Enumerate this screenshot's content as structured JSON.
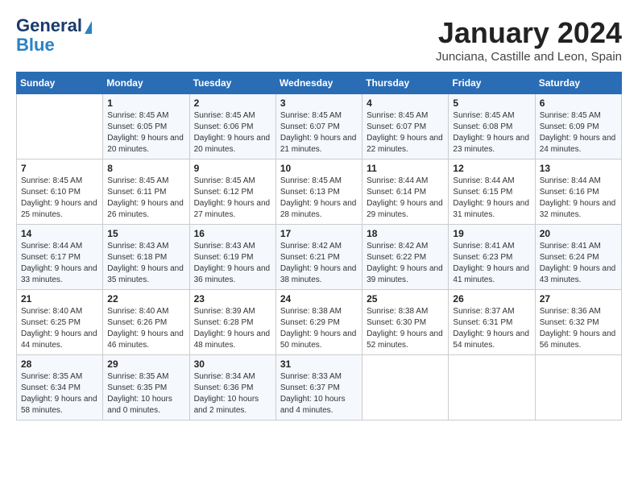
{
  "logo": {
    "line1": "General",
    "line2": "Blue"
  },
  "title": "January 2024",
  "subtitle": "Junciana, Castille and Leon, Spain",
  "weekdays": [
    "Sunday",
    "Monday",
    "Tuesday",
    "Wednesday",
    "Thursday",
    "Friday",
    "Saturday"
  ],
  "weeks": [
    [
      {
        "day": "",
        "sunrise": "",
        "sunset": "",
        "daylight": ""
      },
      {
        "day": "1",
        "sunrise": "Sunrise: 8:45 AM",
        "sunset": "Sunset: 6:05 PM",
        "daylight": "Daylight: 9 hours and 20 minutes."
      },
      {
        "day": "2",
        "sunrise": "Sunrise: 8:45 AM",
        "sunset": "Sunset: 6:06 PM",
        "daylight": "Daylight: 9 hours and 20 minutes."
      },
      {
        "day": "3",
        "sunrise": "Sunrise: 8:45 AM",
        "sunset": "Sunset: 6:07 PM",
        "daylight": "Daylight: 9 hours and 21 minutes."
      },
      {
        "day": "4",
        "sunrise": "Sunrise: 8:45 AM",
        "sunset": "Sunset: 6:07 PM",
        "daylight": "Daylight: 9 hours and 22 minutes."
      },
      {
        "day": "5",
        "sunrise": "Sunrise: 8:45 AM",
        "sunset": "Sunset: 6:08 PM",
        "daylight": "Daylight: 9 hours and 23 minutes."
      },
      {
        "day": "6",
        "sunrise": "Sunrise: 8:45 AM",
        "sunset": "Sunset: 6:09 PM",
        "daylight": "Daylight: 9 hours and 24 minutes."
      }
    ],
    [
      {
        "day": "7",
        "sunrise": "Sunrise: 8:45 AM",
        "sunset": "Sunset: 6:10 PM",
        "daylight": "Daylight: 9 hours and 25 minutes."
      },
      {
        "day": "8",
        "sunrise": "Sunrise: 8:45 AM",
        "sunset": "Sunset: 6:11 PM",
        "daylight": "Daylight: 9 hours and 26 minutes."
      },
      {
        "day": "9",
        "sunrise": "Sunrise: 8:45 AM",
        "sunset": "Sunset: 6:12 PM",
        "daylight": "Daylight: 9 hours and 27 minutes."
      },
      {
        "day": "10",
        "sunrise": "Sunrise: 8:45 AM",
        "sunset": "Sunset: 6:13 PM",
        "daylight": "Daylight: 9 hours and 28 minutes."
      },
      {
        "day": "11",
        "sunrise": "Sunrise: 8:44 AM",
        "sunset": "Sunset: 6:14 PM",
        "daylight": "Daylight: 9 hours and 29 minutes."
      },
      {
        "day": "12",
        "sunrise": "Sunrise: 8:44 AM",
        "sunset": "Sunset: 6:15 PM",
        "daylight": "Daylight: 9 hours and 31 minutes."
      },
      {
        "day": "13",
        "sunrise": "Sunrise: 8:44 AM",
        "sunset": "Sunset: 6:16 PM",
        "daylight": "Daylight: 9 hours and 32 minutes."
      }
    ],
    [
      {
        "day": "14",
        "sunrise": "Sunrise: 8:44 AM",
        "sunset": "Sunset: 6:17 PM",
        "daylight": "Daylight: 9 hours and 33 minutes."
      },
      {
        "day": "15",
        "sunrise": "Sunrise: 8:43 AM",
        "sunset": "Sunset: 6:18 PM",
        "daylight": "Daylight: 9 hours and 35 minutes."
      },
      {
        "day": "16",
        "sunrise": "Sunrise: 8:43 AM",
        "sunset": "Sunset: 6:19 PM",
        "daylight": "Daylight: 9 hours and 36 minutes."
      },
      {
        "day": "17",
        "sunrise": "Sunrise: 8:42 AM",
        "sunset": "Sunset: 6:21 PM",
        "daylight": "Daylight: 9 hours and 38 minutes."
      },
      {
        "day": "18",
        "sunrise": "Sunrise: 8:42 AM",
        "sunset": "Sunset: 6:22 PM",
        "daylight": "Daylight: 9 hours and 39 minutes."
      },
      {
        "day": "19",
        "sunrise": "Sunrise: 8:41 AM",
        "sunset": "Sunset: 6:23 PM",
        "daylight": "Daylight: 9 hours and 41 minutes."
      },
      {
        "day": "20",
        "sunrise": "Sunrise: 8:41 AM",
        "sunset": "Sunset: 6:24 PM",
        "daylight": "Daylight: 9 hours and 43 minutes."
      }
    ],
    [
      {
        "day": "21",
        "sunrise": "Sunrise: 8:40 AM",
        "sunset": "Sunset: 6:25 PM",
        "daylight": "Daylight: 9 hours and 44 minutes."
      },
      {
        "day": "22",
        "sunrise": "Sunrise: 8:40 AM",
        "sunset": "Sunset: 6:26 PM",
        "daylight": "Daylight: 9 hours and 46 minutes."
      },
      {
        "day": "23",
        "sunrise": "Sunrise: 8:39 AM",
        "sunset": "Sunset: 6:28 PM",
        "daylight": "Daylight: 9 hours and 48 minutes."
      },
      {
        "day": "24",
        "sunrise": "Sunrise: 8:38 AM",
        "sunset": "Sunset: 6:29 PM",
        "daylight": "Daylight: 9 hours and 50 minutes."
      },
      {
        "day": "25",
        "sunrise": "Sunrise: 8:38 AM",
        "sunset": "Sunset: 6:30 PM",
        "daylight": "Daylight: 9 hours and 52 minutes."
      },
      {
        "day": "26",
        "sunrise": "Sunrise: 8:37 AM",
        "sunset": "Sunset: 6:31 PM",
        "daylight": "Daylight: 9 hours and 54 minutes."
      },
      {
        "day": "27",
        "sunrise": "Sunrise: 8:36 AM",
        "sunset": "Sunset: 6:32 PM",
        "daylight": "Daylight: 9 hours and 56 minutes."
      }
    ],
    [
      {
        "day": "28",
        "sunrise": "Sunrise: 8:35 AM",
        "sunset": "Sunset: 6:34 PM",
        "daylight": "Daylight: 9 hours and 58 minutes."
      },
      {
        "day": "29",
        "sunrise": "Sunrise: 8:35 AM",
        "sunset": "Sunset: 6:35 PM",
        "daylight": "Daylight: 10 hours and 0 minutes."
      },
      {
        "day": "30",
        "sunrise": "Sunrise: 8:34 AM",
        "sunset": "Sunset: 6:36 PM",
        "daylight": "Daylight: 10 hours and 2 minutes."
      },
      {
        "day": "31",
        "sunrise": "Sunrise: 8:33 AM",
        "sunset": "Sunset: 6:37 PM",
        "daylight": "Daylight: 10 hours and 4 minutes."
      },
      {
        "day": "",
        "sunrise": "",
        "sunset": "",
        "daylight": ""
      },
      {
        "day": "",
        "sunrise": "",
        "sunset": "",
        "daylight": ""
      },
      {
        "day": "",
        "sunrise": "",
        "sunset": "",
        "daylight": ""
      }
    ]
  ]
}
